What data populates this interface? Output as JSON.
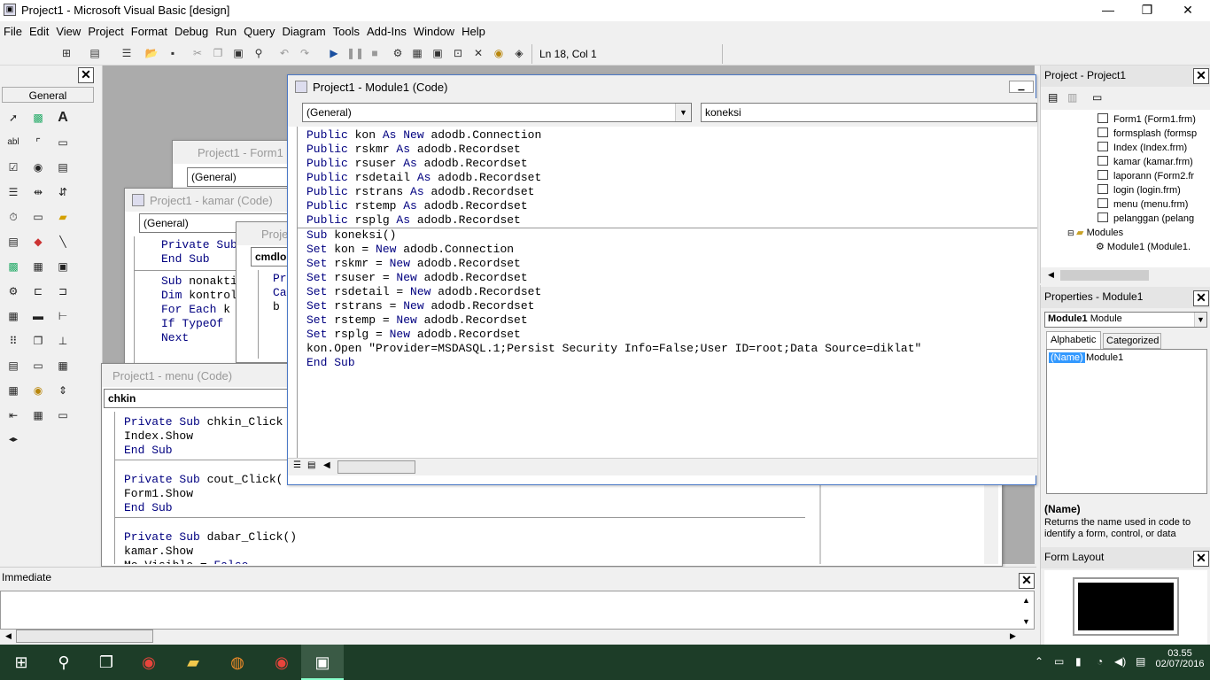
{
  "window": {
    "title": "Project1 - Microsoft Visual Basic [design]",
    "minimize_glyph": "—",
    "restore_glyph": "❐",
    "close_glyph": "✕"
  },
  "menu": [
    "File",
    "Edit",
    "View",
    "Project",
    "Format",
    "Debug",
    "Run",
    "Query",
    "Diagram",
    "Tools",
    "Add-Ins",
    "Window",
    "Help"
  ],
  "toolbar": {
    "icons": [
      "add-project-icon",
      "add-form-icon",
      "menu-editor-icon",
      "open-project-icon",
      "save-project-icon",
      "cut-icon",
      "copy-icon",
      "paste-icon",
      "find-icon",
      "undo-icon",
      "redo-icon",
      "start-icon",
      "break-icon",
      "end-icon",
      "project-explorer-icon",
      "properties-window-icon",
      "form-layout-icon",
      "object-browser-icon",
      "toolbox-icon",
      "data-view-icon",
      "visual-component-manager-icon"
    ],
    "status": "Ln 18, Col 1"
  },
  "toolbox": {
    "tab_label": "General",
    "close_glyph": "✕"
  },
  "windows": {
    "form1": {
      "title": "Project1 - Form1 (C",
      "combo": "(General)"
    },
    "kamar": {
      "title": "Project1 - kamar (Code)",
      "combo": "(General)",
      "lines": [
        "Private Sub",
        "",
        "End Sub",
        "",
        "Sub nonakti",
        "Dim kontrol",
        "For Each k",
        "If TypeOf",
        "Next"
      ]
    },
    "proj3": {
      "title": "Proje",
      "combo": "cmdlo",
      "lines": [
        "Pr",
        "Ca",
        "",
        "",
        "b"
      ]
    },
    "menu": {
      "title": "Project1 - menu (Code)",
      "combo": "chkin",
      "lines": [
        "Private Sub chkin_Click",
        "Index.Show",
        "End Sub",
        "",
        "Private Sub cout_Click(",
        "Form1.Show",
        "End Sub",
        "",
        "Private Sub dabar_Click()",
        "kamar.Show",
        "Me.Visible = False"
      ]
    },
    "module1": {
      "title": "Project1 - Module1 (Code)",
      "object_combo": "(General)",
      "proc_combo": "koneksi",
      "declarations": [
        [
          "Public",
          "kon",
          "As New",
          "adodb.Connection"
        ],
        [
          "Public",
          "rskmr",
          "As",
          "adodb.Recordset"
        ],
        [
          "Public",
          "rsuser",
          "As",
          "adodb.Recordset"
        ],
        [
          "Public",
          "rsdetail",
          "As",
          "adodb.Recordset"
        ],
        [
          "Public",
          "rstrans",
          "As",
          "adodb.Recordset"
        ],
        [
          "Public",
          "rstemp",
          "As",
          "adodb.Recordset"
        ],
        [
          "Public",
          "rsplg",
          "As",
          "adodb.Recordset"
        ]
      ],
      "procedure": [
        "Sub koneksi()",
        "Set kon = New adodb.Connection",
        "Set rskmr = New adodb.Recordset",
        "Set rsuser = New adodb.Recordset",
        "Set rsdetail = New adodb.Recordset",
        "Set rstrans = New adodb.Recordset",
        "Set rstemp = New adodb.Recordset",
        "Set rsplg = New adodb.Recordset",
        "kon.Open \"Provider=MSDASQL.1;Persist Security Info=False;User ID=root;Data Source=diklat\"",
        "End Sub"
      ]
    }
  },
  "project_explorer": {
    "title": "Project - Project1",
    "items": [
      "Form1 (Form1.frm)",
      "formsplash (formsp",
      "Index (Index.frm)",
      "kamar (kamar.frm)",
      "laporann (Form2.fr",
      "login (login.frm)",
      "menu (menu.frm)",
      "pelanggan (pelang"
    ],
    "modules_folder": "Modules",
    "module_item": "Module1 (Module1."
  },
  "properties": {
    "title": "Properties - Module1",
    "object_name": "Module1",
    "object_type": "Module",
    "tab_alpha": "Alphabetic",
    "tab_categorized": "Categorized",
    "prop_name": "(Name)",
    "prop_value": "Module1",
    "desc_title": "(Name)",
    "desc_text": "Returns the name used in code to identify a form, control, or data"
  },
  "form_layout": {
    "title": "Form Layout"
  },
  "immediate": {
    "title": "Immediate"
  },
  "taskbar": {
    "time": "03.55",
    "date": "02/07/2016",
    "apps": [
      "start-icon",
      "search-icon",
      "task-view-icon",
      "chrome-icon",
      "file-explorer-icon",
      "firefox-icon",
      "chrome-user-icon",
      "visual-basic-icon"
    ]
  },
  "colors": {
    "keyword": "#000080",
    "taskbar": "#1d3d28",
    "selection": "#3399ff"
  }
}
